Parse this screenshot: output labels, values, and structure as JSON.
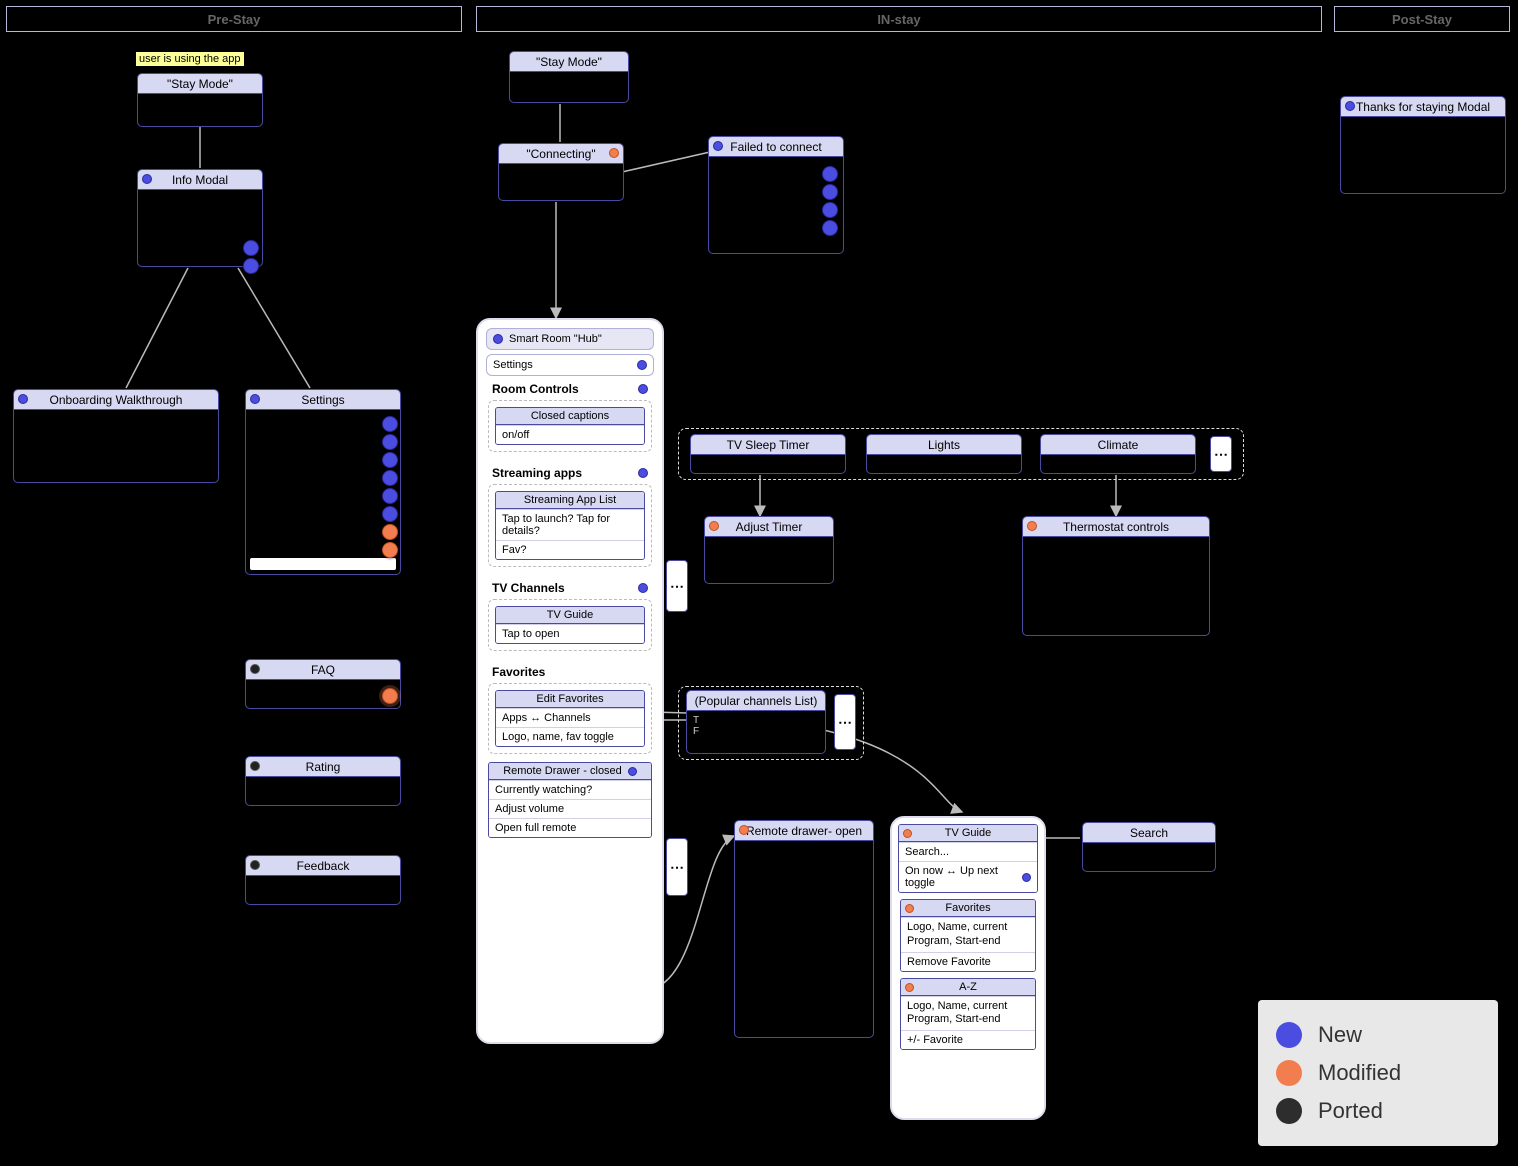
{
  "phases": {
    "pre": "Pre-Stay",
    "in": "IN-stay",
    "post": "Post-Stay"
  },
  "annot": {
    "appUse": "user is using the app"
  },
  "legend": {
    "new": "New",
    "modified": "Modified",
    "ported": "Ported"
  },
  "prestay": {
    "stayMode": "\"Stay Mode\"",
    "infoModal": "Info Modal",
    "onboarding": "Onboarding Walkthrough",
    "settings": "Settings",
    "faq": "FAQ",
    "rating": "Rating",
    "feedback": "Feedback"
  },
  "instay": {
    "stayMode": "\"Stay Mode\"",
    "connecting": "\"Connecting\"",
    "failed": "Failed to connect",
    "hub": {
      "title": "Smart Room \"Hub\"",
      "settings": "Settings",
      "roomControls": "Room Controls",
      "cc_title": "Closed captions",
      "cc_val": "on/off",
      "streaming": "Streaming apps",
      "streamList_title": "Streaming App List",
      "streamList_r1": "Tap to launch? Tap for details?",
      "streamList_r2": "Fav?",
      "tvch": "TV Channels",
      "tvGuide_title": "TV Guide",
      "tvGuide_r1": "Tap to open",
      "favs": "Favorites",
      "editFav_title": "Edit Favorites",
      "editFav_r1": "Apps ↔ Channels",
      "editFav_r2": "Logo, name, fav toggle",
      "remoteClosed_title": "Remote Drawer - closed",
      "remoteClosed_r1": "Currently watching?",
      "remoteClosed_r2": "Adjust volume",
      "remoteClosed_r3": "Open full remote"
    },
    "tvSleep": "TV Sleep Timer",
    "lights": "Lights",
    "climate": "Climate",
    "ellipsis": "⋯",
    "adjustTimer": "Adjust Timer",
    "thermo": "Thermostat controls",
    "popular": "(Popular channels List)",
    "pop_r1": "T",
    "pop_r2": "F",
    "remoteOpen": "Remote drawer- open",
    "tvGuidePanel": {
      "title": "TV Guide",
      "search": "Search...",
      "toggle": "On now ↔ Up next toggle",
      "fav_title": "Favorites",
      "fav_r1": "Logo, Name, current Program, Start-end",
      "fav_r2": "Remove Favorite",
      "az_title": "A-Z",
      "az_r1": "Logo, Name, current Program, Start-end",
      "az_r2": "+/- Favorite"
    },
    "search": "Search"
  },
  "poststay": {
    "thanks": "Thanks for staying Modal"
  }
}
